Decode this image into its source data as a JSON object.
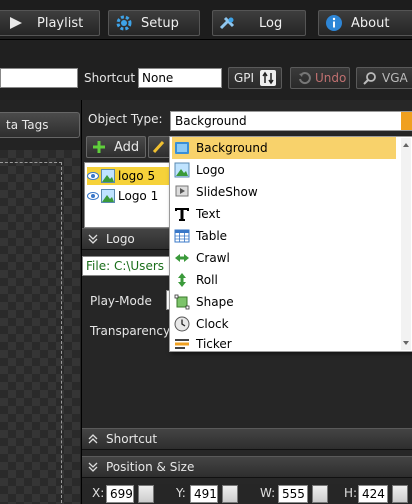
{
  "nav": {
    "playlist": "Playlist",
    "setup": "Setup",
    "log": "Log",
    "about": "About"
  },
  "toolbar": {
    "shortcut_label": "Shortcut",
    "shortcut_value": "None",
    "gpi_label": "GPI",
    "undo_label": "Undo",
    "vga_label": "VGA"
  },
  "left_panel": {
    "meta_tab": "ta Tags"
  },
  "object": {
    "type_label": "Object Type:",
    "type_value": "Background",
    "add_label": "Add"
  },
  "layers": [
    {
      "name": "logo 5",
      "selected": true
    },
    {
      "name": "Logo 1",
      "selected": false
    }
  ],
  "dropdown": {
    "options": [
      {
        "label": "Background",
        "icon": "background-icon",
        "highlighted": true
      },
      {
        "label": "Logo",
        "icon": "logo-icon"
      },
      {
        "label": "SlideShow",
        "icon": "slideshow-icon"
      },
      {
        "label": "Text",
        "icon": "text-icon"
      },
      {
        "label": "Table",
        "icon": "table-icon"
      },
      {
        "label": "Crawl",
        "icon": "crawl-icon"
      },
      {
        "label": "Roll",
        "icon": "roll-icon"
      },
      {
        "label": "Shape",
        "icon": "shape-icon"
      },
      {
        "label": "Clock",
        "icon": "clock-icon"
      },
      {
        "label": "Ticker",
        "icon": "ticker-icon"
      }
    ]
  },
  "logo_section": {
    "title": "Logo",
    "file": "File: C:\\Users",
    "play_mode": "Play-Mode",
    "transparency": "Transparency"
  },
  "sections": {
    "shortcut": "Shortcut",
    "position_size": "Position & Size"
  },
  "position": {
    "x_label": "X:",
    "x": "699",
    "y_label": "Y:",
    "y": "491",
    "w_label": "W:",
    "w": "555",
    "h_label": "H:",
    "h": "424"
  },
  "colors": {
    "highlight": "#f8d26b",
    "layer_selected": "#f6d23a",
    "file_text": "#1a6e1a",
    "accent_orange": "#f0a020"
  }
}
